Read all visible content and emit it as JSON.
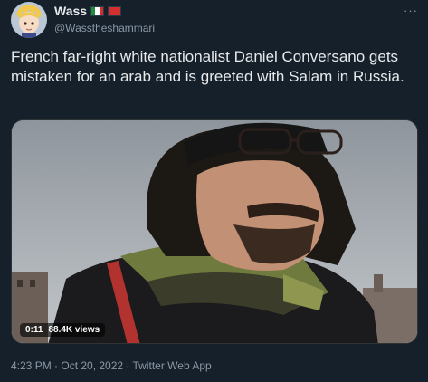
{
  "author": {
    "display_name": "Wass",
    "handle": "@Wasstheshammari",
    "flags": [
      "mexico-flag",
      "red-flag"
    ]
  },
  "tweet": {
    "text": "French far-right white nationalist Daniel Conversano gets mistaken for an arab and is greeted with Salam in Russia.",
    "timestamp": "4:23 PM · Oct 20, 2022 · Twitter Web App"
  },
  "video": {
    "duration": "0:11",
    "views": "88.4K views"
  },
  "icons": {
    "more": "more-options-icon"
  },
  "colors": {
    "background": "#15202b",
    "text_primary": "#e7e9ea",
    "text_secondary": "#8b98a5"
  }
}
